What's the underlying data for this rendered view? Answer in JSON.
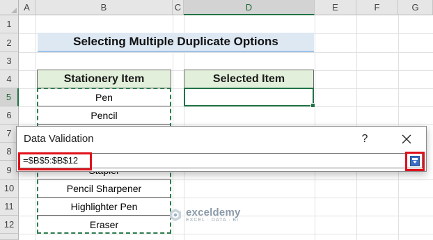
{
  "columns": [
    "A",
    "B",
    "C",
    "D",
    "E",
    "F",
    "G"
  ],
  "selected_column": "D",
  "rows": [
    "1",
    "2",
    "3",
    "4",
    "5",
    "6",
    "7",
    "8",
    "9",
    "10",
    "11",
    "12"
  ],
  "selected_row": "5",
  "sheet": {
    "title": "Selecting Multiple Duplicate Options",
    "list_header": "Stationery Item",
    "selected_header": "Selected Item",
    "items": [
      "Pen",
      "Pencil",
      "",
      "",
      "Stapler",
      "Pencil Sharpener",
      "Highlighter Pen",
      "Eraser"
    ],
    "selected_value": ""
  },
  "dialog": {
    "title": "Data Validation",
    "help_label": "?",
    "reference": "=$B$5:$B$12"
  },
  "watermark": {
    "name": "exceldemy",
    "tagline": "EXCEL · DATA · BI"
  },
  "colors": {
    "accent": "#217346",
    "highlight": "#e0111a",
    "header_fill": "#e2efda",
    "title_fill": "#dde8f3"
  }
}
